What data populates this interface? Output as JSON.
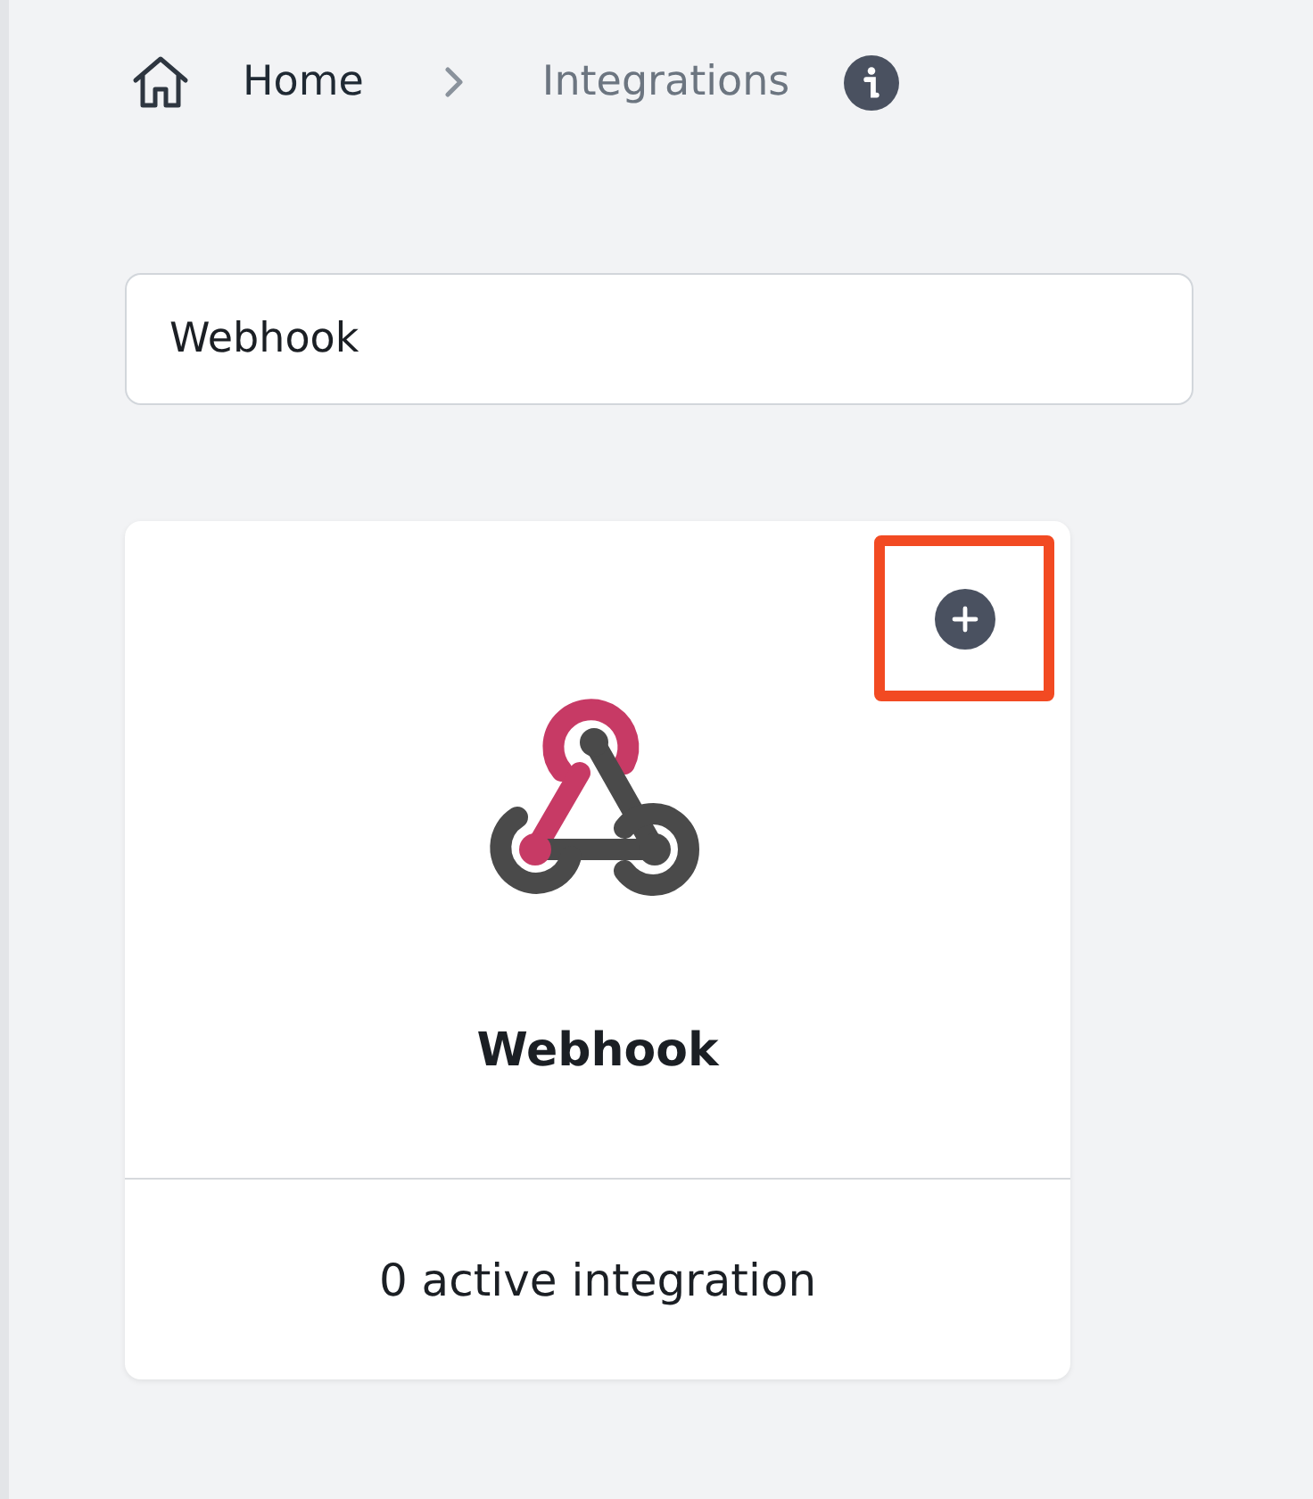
{
  "breadcrumb": [
    {
      "label": "Home",
      "kind": "home"
    },
    {
      "label": "Integrations",
      "kind": "current"
    }
  ],
  "search": {
    "value": "Webhook"
  },
  "cards": [
    {
      "title": "Webhook",
      "footer": "0 active integration",
      "add_highlighted": true
    }
  ]
}
